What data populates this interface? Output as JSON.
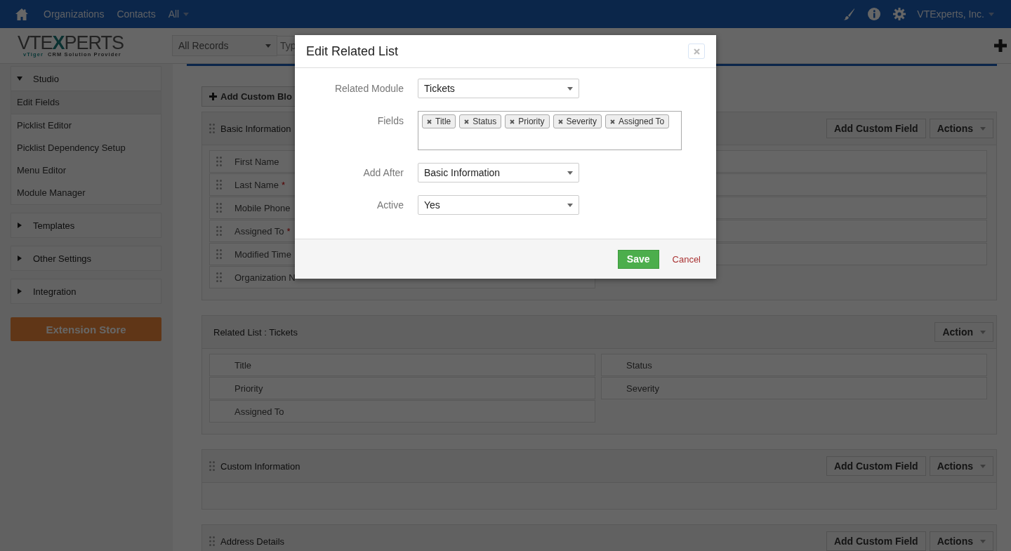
{
  "top_nav": {
    "items": [
      {
        "label": "Organizations",
        "dropdown": false
      },
      {
        "label": "Contacts",
        "dropdown": false
      },
      {
        "label": "All",
        "dropdown": true
      }
    ],
    "user": {
      "label": "VTExperts, Inc.",
      "dropdown": true
    }
  },
  "logo": {
    "parts": [
      "VTE",
      "X",
      "PERTS"
    ],
    "tagline": [
      "vTiger",
      "CRM Solution Provider"
    ]
  },
  "filter": {
    "value": "All Records"
  },
  "search": {
    "placeholder": "Typ"
  },
  "sidebar": {
    "sections": [
      {
        "label": "Studio",
        "expanded": true,
        "items": [
          {
            "label": "Edit Fields",
            "selected": true
          },
          {
            "label": "Picklist Editor",
            "selected": false
          },
          {
            "label": "Picklist Dependency Setup",
            "selected": false
          },
          {
            "label": "Menu Editor",
            "selected": false
          },
          {
            "label": "Module Manager",
            "selected": false
          }
        ]
      },
      {
        "label": "Templates",
        "expanded": false
      },
      {
        "label": "Other Settings",
        "expanded": false
      },
      {
        "label": "Integration",
        "expanded": false
      }
    ],
    "store_button": "Extension Store"
  },
  "main": {
    "add_block_button": "Add Custom Blo",
    "blocks": [
      {
        "kind": "fields",
        "title": "Basic Information",
        "draggable": true,
        "buttons": [
          {
            "kind": "button",
            "label": "Add Custom Field"
          },
          {
            "kind": "dropdown",
            "label": "Actions"
          }
        ],
        "rows": [
          {
            "cells": [
              {
                "kind": "field",
                "label": "First Name"
              },
              {
                "kind": "blank"
              }
            ]
          },
          {
            "cells": [
              {
                "kind": "field",
                "label": "Last Name",
                "mark": "*"
              },
              {
                "kind": "blank"
              }
            ]
          },
          {
            "cells": [
              {
                "kind": "field",
                "label": "Mobile Phone"
              },
              {
                "kind": "blank"
              }
            ]
          },
          {
            "cells": [
              {
                "kind": "field",
                "label": "Assigned To",
                "mark": "*"
              },
              {
                "kind": "blank"
              }
            ]
          },
          {
            "cells": [
              {
                "kind": "field",
                "label": "Modified Time"
              },
              {
                "kind": "blank"
              }
            ]
          },
          {
            "cells": [
              {
                "kind": "field",
                "label": "Organization N"
              }
            ]
          }
        ]
      },
      {
        "kind": "related",
        "title": "Related List : Tickets",
        "draggable": false,
        "buttons": [
          {
            "kind": "dropdown",
            "label": "Action"
          }
        ],
        "rows": [
          {
            "cells": [
              {
                "kind": "field",
                "label": "Title"
              },
              {
                "kind": "field",
                "label": "Status"
              }
            ]
          },
          {
            "cells": [
              {
                "kind": "field",
                "label": "Priority"
              },
              {
                "kind": "field",
                "label": "Severity"
              }
            ]
          },
          {
            "cells": [
              {
                "kind": "field",
                "label": "Assigned To"
              }
            ]
          }
        ]
      },
      {
        "kind": "fields",
        "title": "Custom Information",
        "draggable": true,
        "buttons": [
          {
            "kind": "button",
            "label": "Add Custom Field"
          },
          {
            "kind": "dropdown",
            "label": "Actions"
          }
        ]
      },
      {
        "kind": "fields",
        "title": "Address Details",
        "draggable": true,
        "buttons": [
          {
            "kind": "button",
            "label": "Add Custom Field"
          },
          {
            "kind": "dropdown",
            "label": "Actions"
          }
        ]
      }
    ]
  },
  "modal": {
    "title": "Edit Related List",
    "rows": [
      {
        "kind": "select",
        "label": "Related Module",
        "value": "Tickets"
      },
      {
        "kind": "tags",
        "label": "Fields",
        "tags": [
          "Title",
          "Status",
          "Priority",
          "Severity",
          "Assigned To"
        ]
      },
      {
        "kind": "select",
        "label": "Add After",
        "value": "Basic Information"
      },
      {
        "kind": "select",
        "label": "Active",
        "value": "Yes"
      }
    ],
    "save": "Save",
    "cancel": "Cancel"
  }
}
